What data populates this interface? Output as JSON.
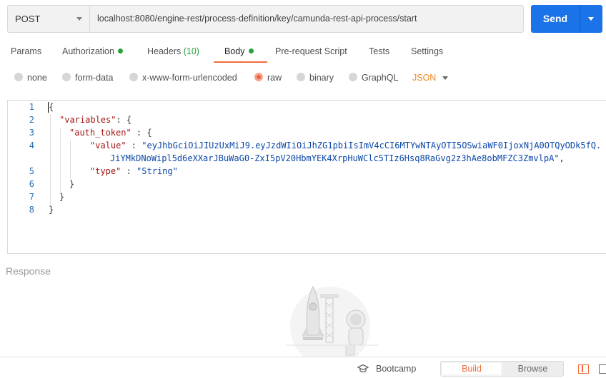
{
  "request": {
    "method": "POST",
    "url": "localhost:8080/engine-rest/process-definition/key/camunda-rest-api-process/start",
    "send_label": "Send"
  },
  "tabs": [
    {
      "label": "Params"
    },
    {
      "label": "Authorization"
    },
    {
      "label": "Headers",
      "count": "(10)"
    },
    {
      "label": "Body"
    },
    {
      "label": "Pre-request Script"
    },
    {
      "label": "Tests"
    },
    {
      "label": "Settings"
    }
  ],
  "active_tab": "Body",
  "body_types": [
    {
      "label": "none"
    },
    {
      "label": "form-data"
    },
    {
      "label": "x-www-form-urlencoded"
    },
    {
      "label": "raw"
    },
    {
      "label": "binary"
    },
    {
      "label": "GraphQL"
    }
  ],
  "selected_body_type": "raw",
  "format": "JSON",
  "editor": {
    "line_numbers": [
      "1",
      "2",
      "3",
      "4",
      "",
      "5",
      "6",
      "7",
      "8"
    ],
    "lines": {
      "l1": "{",
      "l2_key": "\"variables\"",
      "l2_rest": ": {",
      "l3_key": "\"auth_token\"",
      "l3_rest": " : {",
      "l4_key": "\"value\"",
      "l4_sep": " : ",
      "l4_val_a": "\"eyJhbGciOiJIUzUxMiJ9.eyJzdWIiOiJhZG1pbiIsImV4cCI6MTYwNTAyOTI5OSwiaWF0IjoxNjA0OTQyODk5fQ.",
      "l4_val_b": "JiYMkDNoWipl5d6eXXarJBuWaG0-ZxI5pV20HbmYEK4XrpHuWClc5TIz6Hsq8RaGvg2z3hAe8obMFZC3ZmvlpA\"",
      "l4_tail": ",",
      "l5_key": "\"type\"",
      "l5_sep": " : ",
      "l5_val": "\"String\"",
      "l6": "}",
      "l7": "}",
      "l8": "}"
    }
  },
  "response_label": "Response",
  "footer": {
    "bootcamp_label": "Bootcamp",
    "build_label": "Build",
    "browse_label": "Browse"
  },
  "colors": {
    "accent": "#f26b3a",
    "send": "#1a73e8",
    "status_dot": "#26a33b",
    "json_format": "#f08a24"
  }
}
